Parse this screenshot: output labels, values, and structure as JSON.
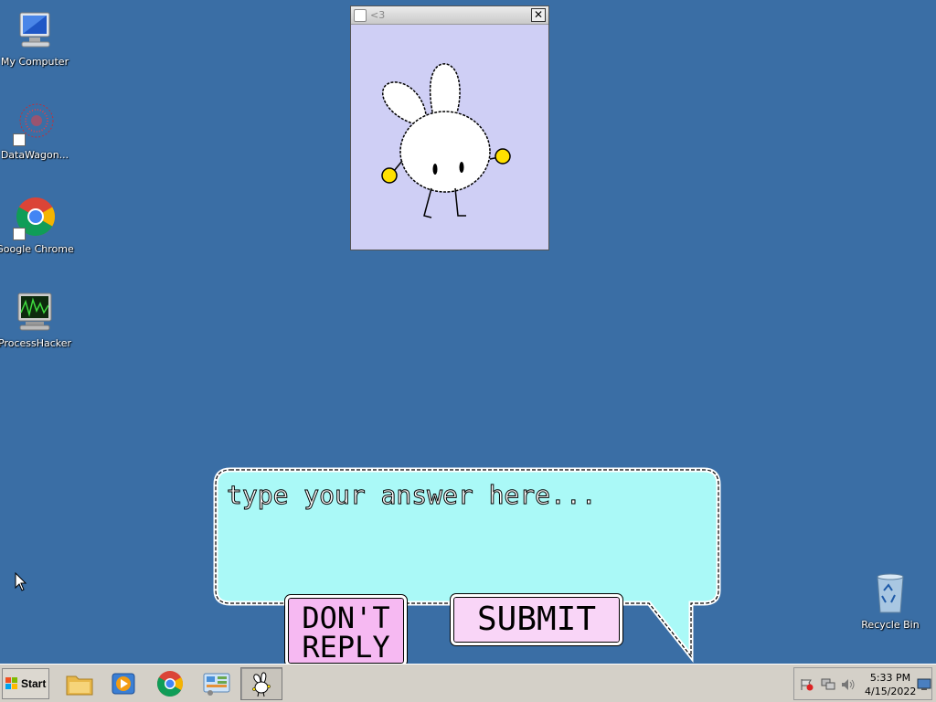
{
  "desktop": {
    "icons": [
      {
        "label": "My Computer"
      },
      {
        "label": "DataWagon..."
      },
      {
        "label": "Google Chrome"
      },
      {
        "label": "ProcessHacker"
      },
      {
        "label": "Recycle Bin"
      }
    ]
  },
  "window": {
    "title": "<3",
    "close_glyph": "✕"
  },
  "reply": {
    "placeholder": "type your answer here...",
    "dont_reply_label": "DON'T\nREPLY",
    "submit_label": "SUBMIT"
  },
  "taskbar": {
    "start_label": "Start",
    "clock_time": "5:33 PM",
    "clock_date": "4/15/2022"
  },
  "colors": {
    "desktop": "#3a6ea5",
    "bubble": "#aaf9f7",
    "button": "#f6b9f2",
    "window_bg": "#cfcff5"
  },
  "icons": {
    "my_computer": "computer-icon",
    "datawagon": "datawagon-icon",
    "chrome": "chrome-icon",
    "processhacker": "processhacker-icon",
    "recycle_bin": "recycle-bin-icon"
  }
}
